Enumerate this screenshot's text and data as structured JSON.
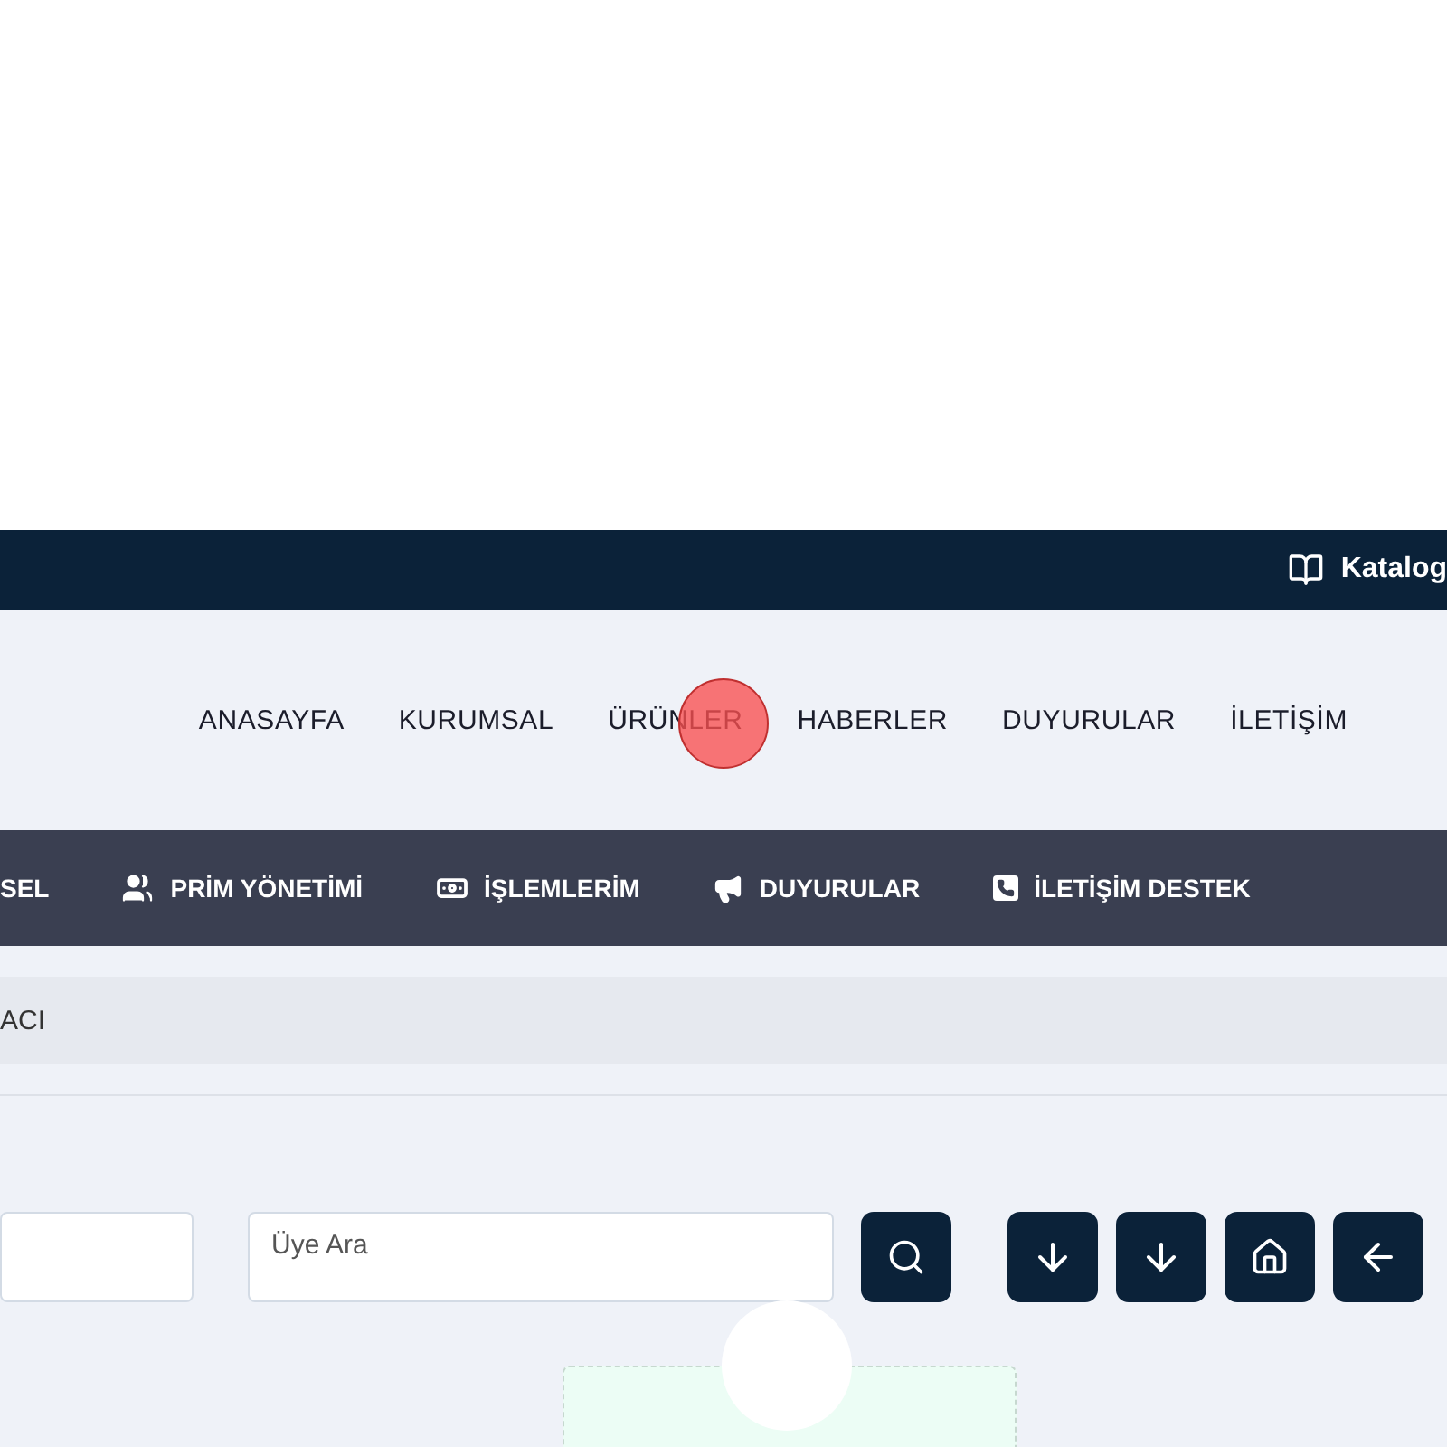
{
  "top_bar": {
    "catalog_link": "Katalog"
  },
  "nav": {
    "links": [
      {
        "label": "ANASAYFA"
      },
      {
        "label": "KURUMSAL"
      },
      {
        "label": "ÜRÜNLER"
      },
      {
        "label": "HABERLER"
      },
      {
        "label": "DUYURULAR"
      },
      {
        "label": "İLETİŞİM"
      }
    ]
  },
  "menu": {
    "items": [
      {
        "label": "SEL"
      },
      {
        "label": "PRİM YÖNETİMİ"
      },
      {
        "label": "İŞLEMLERİM"
      },
      {
        "label": "DUYURULAR"
      },
      {
        "label": "İLETİŞİM DESTEK"
      }
    ]
  },
  "breadcrumb": {
    "text": "ACI"
  },
  "search": {
    "placeholder": "Üye Ara"
  }
}
